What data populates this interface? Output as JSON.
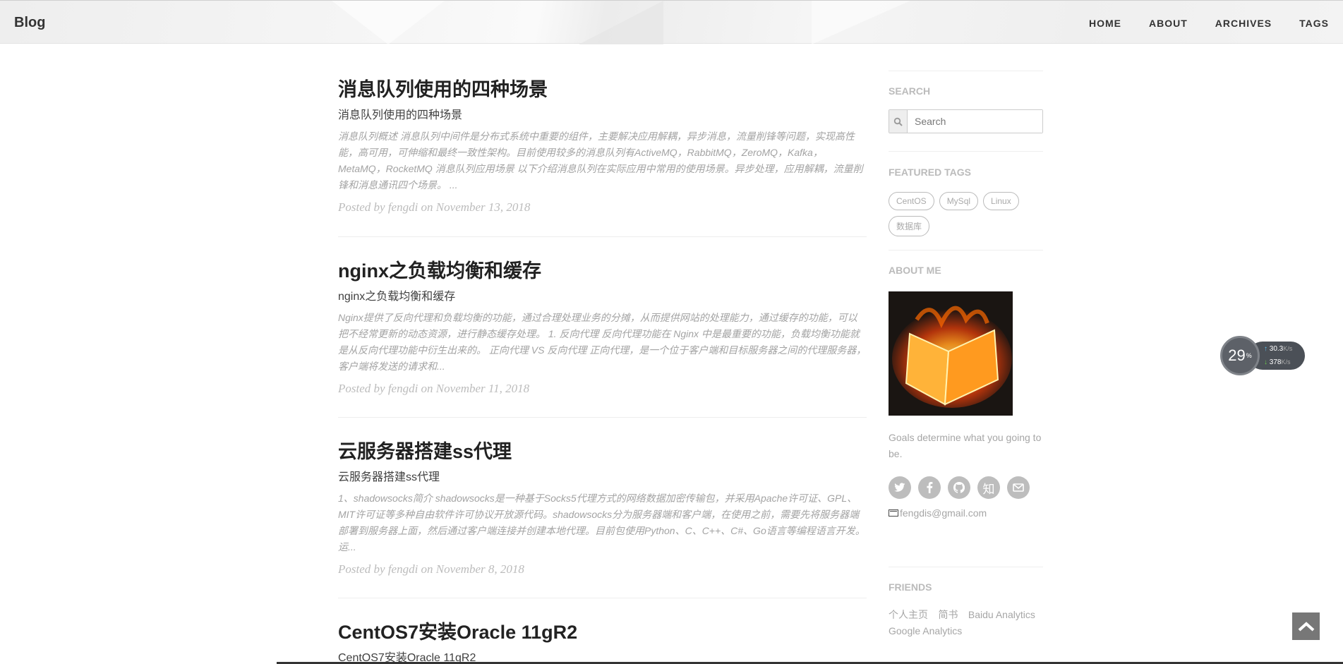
{
  "navbar": {
    "brand": "Blog",
    "links": [
      "HOME",
      "ABOUT",
      "ARCHIVES",
      "TAGS"
    ]
  },
  "posts": [
    {
      "title": "消息队列使用的四种场景",
      "subtitle": "消息队列使用的四种场景",
      "excerpt": "消息队列概述 消息队列中间件是分布式系统中重要的组件，主要解决应用解耦，异步消息，流量削锋等问题，实现高性能，高可用，可伸缩和最终一致性架构。目前使用较多的消息队列有ActiveMQ，RabbitMQ，ZeroMQ，Kafka，MetaMQ，RocketMQ 消息队列应用场景 以下介绍消息队列在实际应用中常用的使用场景。异步处理，应用解耦，流量削锋和消息通讯四个场景。 ...",
      "meta": "Posted by fengdi on November 13, 2018"
    },
    {
      "title": "nginx之负载均衡和缓存",
      "subtitle": "nginx之负载均衡和缓存",
      "excerpt": "Nginx提供了反向代理和负载均衡的功能，通过合理处理业务的分摊，从而提供网站的处理能力，通过缓存的功能，可以把不经常更新的动态资源，进行静态缓存处理。 1. 反向代理 反向代理功能在 Nginx 中是最重要的功能，负载均衡功能就是从反向代理功能中衍生出来的。 正向代理 VS 反向代理 正向代理，是一个位于客户端和目标服务器之间的代理服务器，客户端将发送的请求和...",
      "meta": "Posted by fengdi on November 11, 2018"
    },
    {
      "title": "云服务器搭建ss代理",
      "subtitle": "云服务器搭建ss代理",
      "excerpt": "1、shadowsocks简介 shadowsocks是一种基于Socks5代理方式的网络数据加密传输包，并采用Apache许可证、GPL、MIT许可证等多种自由软件许可协议开放源代码。shadowsocks分为服务器端和客户端，在使用之前，需要先将服务器端部署到服务器上面，然后通过客户端连接并创建本地代理。目前包使用Python、C、C++、C#、Go语言等编程语言开发。 运...",
      "meta": "Posted by fengdi on November 8, 2018"
    },
    {
      "title": "CentOS7安装Oracle 11gR2",
      "subtitle": "CentOS7安装Oracle 11gR2"
    }
  ],
  "sidebar": {
    "search_title": "SEARCH",
    "search_placeholder": "Search",
    "tags_title": "FEATURED TAGS",
    "tags": [
      "CentOS",
      "MySql",
      "Linux",
      "数据库"
    ],
    "about_title": "ABOUT ME",
    "goals": "Goals determine what you going to be.",
    "social_icons": [
      "twitter-icon",
      "facebook-icon",
      "github-icon",
      "zhihu-icon",
      "mail-icon"
    ],
    "zhihu_glyph": "知",
    "email": "fengdis@gmail.com",
    "friends_title": "FRIENDS",
    "friends": [
      "个人主页",
      "简书",
      "Baidu Analytics",
      "Google Analytics"
    ]
  },
  "speed_widget": {
    "percent": "29",
    "percent_unit": "%",
    "upload": "30.3",
    "download": "378",
    "unit": "K/s"
  }
}
